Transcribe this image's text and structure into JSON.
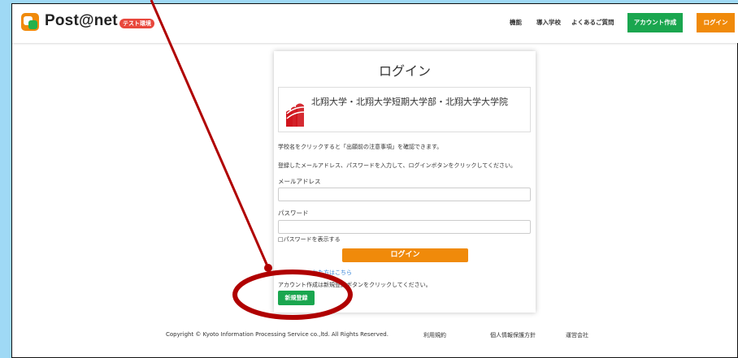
{
  "header": {
    "brand": "Post@net",
    "badge": "テスト環境",
    "nav": [
      "機能",
      "導入学校",
      "よくあるご質問"
    ],
    "signup_button": "アカウント作成",
    "login_button": "ログイン"
  },
  "login": {
    "title": "ログイン",
    "school_name": "北翔大学・北翔大学短期大学部・北翔大学大学院",
    "school_note": "学校名をクリックすると「出願前の注意事項」を確認できます。",
    "instructions": "登録したメールアドレス、パスワードを入力して、ログインボタンをクリックしてください。",
    "email_label": "メールアドレス",
    "email_value": "",
    "password_label": "パスワード",
    "password_value": "",
    "show_password": "□パスワードを表示する",
    "login_button": "ログイン",
    "forgot_link": "れた方はこちら",
    "register_note": "アカウント作成は新規登録ボタンをクリックしてください。",
    "register_button": "新規登録"
  },
  "footer": {
    "copyright": "Copyright © Kyoto Information Processing Service co.,ltd. All Rights Reserved.",
    "links": [
      "利用規約",
      "個人情報保護方針",
      "運営会社"
    ]
  },
  "colors": {
    "accent_orange": "#f08a0a",
    "accent_green": "#1aa64f",
    "annotation_red": "#b00000",
    "background": "#9fd9f5"
  }
}
